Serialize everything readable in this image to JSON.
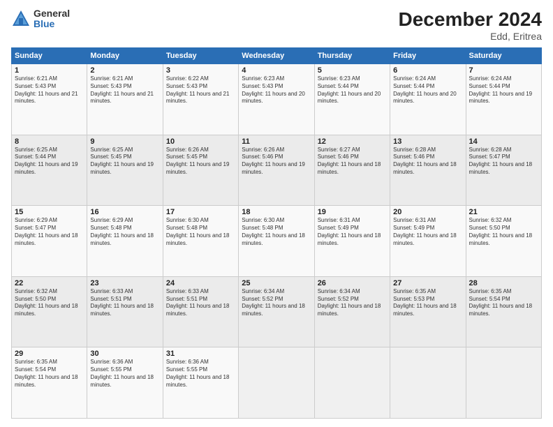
{
  "logo": {
    "general": "General",
    "blue": "Blue"
  },
  "title": "December 2024",
  "subtitle": "Edd, Eritrea",
  "columns": [
    "Sunday",
    "Monday",
    "Tuesday",
    "Wednesday",
    "Thursday",
    "Friday",
    "Saturday"
  ],
  "weeks": [
    [
      {
        "day": "1",
        "sunrise": "Sunrise: 6:21 AM",
        "sunset": "Sunset: 5:43 PM",
        "daylight": "Daylight: 11 hours and 21 minutes."
      },
      {
        "day": "2",
        "sunrise": "Sunrise: 6:21 AM",
        "sunset": "Sunset: 5:43 PM",
        "daylight": "Daylight: 11 hours and 21 minutes."
      },
      {
        "day": "3",
        "sunrise": "Sunrise: 6:22 AM",
        "sunset": "Sunset: 5:43 PM",
        "daylight": "Daylight: 11 hours and 21 minutes."
      },
      {
        "day": "4",
        "sunrise": "Sunrise: 6:23 AM",
        "sunset": "Sunset: 5:43 PM",
        "daylight": "Daylight: 11 hours and 20 minutes."
      },
      {
        "day": "5",
        "sunrise": "Sunrise: 6:23 AM",
        "sunset": "Sunset: 5:44 PM",
        "daylight": "Daylight: 11 hours and 20 minutes."
      },
      {
        "day": "6",
        "sunrise": "Sunrise: 6:24 AM",
        "sunset": "Sunset: 5:44 PM",
        "daylight": "Daylight: 11 hours and 20 minutes."
      },
      {
        "day": "7",
        "sunrise": "Sunrise: 6:24 AM",
        "sunset": "Sunset: 5:44 PM",
        "daylight": "Daylight: 11 hours and 19 minutes."
      }
    ],
    [
      {
        "day": "8",
        "sunrise": "Sunrise: 6:25 AM",
        "sunset": "Sunset: 5:44 PM",
        "daylight": "Daylight: 11 hours and 19 minutes."
      },
      {
        "day": "9",
        "sunrise": "Sunrise: 6:25 AM",
        "sunset": "Sunset: 5:45 PM",
        "daylight": "Daylight: 11 hours and 19 minutes."
      },
      {
        "day": "10",
        "sunrise": "Sunrise: 6:26 AM",
        "sunset": "Sunset: 5:45 PM",
        "daylight": "Daylight: 11 hours and 19 minutes."
      },
      {
        "day": "11",
        "sunrise": "Sunrise: 6:26 AM",
        "sunset": "Sunset: 5:46 PM",
        "daylight": "Daylight: 11 hours and 19 minutes."
      },
      {
        "day": "12",
        "sunrise": "Sunrise: 6:27 AM",
        "sunset": "Sunset: 5:46 PM",
        "daylight": "Daylight: 11 hours and 18 minutes."
      },
      {
        "day": "13",
        "sunrise": "Sunrise: 6:28 AM",
        "sunset": "Sunset: 5:46 PM",
        "daylight": "Daylight: 11 hours and 18 minutes."
      },
      {
        "day": "14",
        "sunrise": "Sunrise: 6:28 AM",
        "sunset": "Sunset: 5:47 PM",
        "daylight": "Daylight: 11 hours and 18 minutes."
      }
    ],
    [
      {
        "day": "15",
        "sunrise": "Sunrise: 6:29 AM",
        "sunset": "Sunset: 5:47 PM",
        "daylight": "Daylight: 11 hours and 18 minutes."
      },
      {
        "day": "16",
        "sunrise": "Sunrise: 6:29 AM",
        "sunset": "Sunset: 5:48 PM",
        "daylight": "Daylight: 11 hours and 18 minutes."
      },
      {
        "day": "17",
        "sunrise": "Sunrise: 6:30 AM",
        "sunset": "Sunset: 5:48 PM",
        "daylight": "Daylight: 11 hours and 18 minutes."
      },
      {
        "day": "18",
        "sunrise": "Sunrise: 6:30 AM",
        "sunset": "Sunset: 5:48 PM",
        "daylight": "Daylight: 11 hours and 18 minutes."
      },
      {
        "day": "19",
        "sunrise": "Sunrise: 6:31 AM",
        "sunset": "Sunset: 5:49 PM",
        "daylight": "Daylight: 11 hours and 18 minutes."
      },
      {
        "day": "20",
        "sunrise": "Sunrise: 6:31 AM",
        "sunset": "Sunset: 5:49 PM",
        "daylight": "Daylight: 11 hours and 18 minutes."
      },
      {
        "day": "21",
        "sunrise": "Sunrise: 6:32 AM",
        "sunset": "Sunset: 5:50 PM",
        "daylight": "Daylight: 11 hours and 18 minutes."
      }
    ],
    [
      {
        "day": "22",
        "sunrise": "Sunrise: 6:32 AM",
        "sunset": "Sunset: 5:50 PM",
        "daylight": "Daylight: 11 hours and 18 minutes."
      },
      {
        "day": "23",
        "sunrise": "Sunrise: 6:33 AM",
        "sunset": "Sunset: 5:51 PM",
        "daylight": "Daylight: 11 hours and 18 minutes."
      },
      {
        "day": "24",
        "sunrise": "Sunrise: 6:33 AM",
        "sunset": "Sunset: 5:51 PM",
        "daylight": "Daylight: 11 hours and 18 minutes."
      },
      {
        "day": "25",
        "sunrise": "Sunrise: 6:34 AM",
        "sunset": "Sunset: 5:52 PM",
        "daylight": "Daylight: 11 hours and 18 minutes."
      },
      {
        "day": "26",
        "sunrise": "Sunrise: 6:34 AM",
        "sunset": "Sunset: 5:52 PM",
        "daylight": "Daylight: 11 hours and 18 minutes."
      },
      {
        "day": "27",
        "sunrise": "Sunrise: 6:35 AM",
        "sunset": "Sunset: 5:53 PM",
        "daylight": "Daylight: 11 hours and 18 minutes."
      },
      {
        "day": "28",
        "sunrise": "Sunrise: 6:35 AM",
        "sunset": "Sunset: 5:54 PM",
        "daylight": "Daylight: 11 hours and 18 minutes."
      }
    ],
    [
      {
        "day": "29",
        "sunrise": "Sunrise: 6:35 AM",
        "sunset": "Sunset: 5:54 PM",
        "daylight": "Daylight: 11 hours and 18 minutes."
      },
      {
        "day": "30",
        "sunrise": "Sunrise: 6:36 AM",
        "sunset": "Sunset: 5:55 PM",
        "daylight": "Daylight: 11 hours and 18 minutes."
      },
      {
        "day": "31",
        "sunrise": "Sunrise: 6:36 AM",
        "sunset": "Sunset: 5:55 PM",
        "daylight": "Daylight: 11 hours and 18 minutes."
      },
      null,
      null,
      null,
      null
    ]
  ]
}
